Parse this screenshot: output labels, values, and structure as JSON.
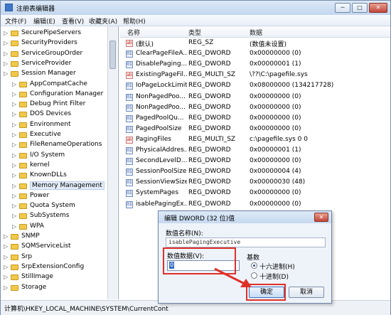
{
  "window": {
    "title": "注册表编辑器",
    "controls": [
      "─",
      "□",
      "✕"
    ]
  },
  "menu": [
    "文件(F)",
    "编辑(E)",
    "查看(V)",
    "收藏夹(A)",
    "帮助(H)"
  ],
  "tree": [
    {
      "label": "SecurePipeServers",
      "indent": 0
    },
    {
      "label": "SecurityProviders",
      "indent": 0
    },
    {
      "label": "ServiceGroupOrder",
      "indent": 0
    },
    {
      "label": "ServiceProvider",
      "indent": 0
    },
    {
      "label": "Session Manager",
      "indent": 0
    },
    {
      "label": "AppCompatCache",
      "indent": 1
    },
    {
      "label": "Configuration Manager",
      "indent": 1
    },
    {
      "label": "Debug Print Filter",
      "indent": 1
    },
    {
      "label": "DOS Devices",
      "indent": 1
    },
    {
      "label": "Environment",
      "indent": 1
    },
    {
      "label": "Executive",
      "indent": 1
    },
    {
      "label": "FileRenameOperations",
      "indent": 1
    },
    {
      "label": "I/O System",
      "indent": 1
    },
    {
      "label": "kernel",
      "indent": 1
    },
    {
      "label": "KnownDLLs",
      "indent": 1
    },
    {
      "label": "Memory Management",
      "indent": 1,
      "selected": true
    },
    {
      "label": "Power",
      "indent": 1
    },
    {
      "label": "Quota System",
      "indent": 1
    },
    {
      "label": "SubSystems",
      "indent": 1
    },
    {
      "label": "WPA",
      "indent": 1
    },
    {
      "label": "SNMP",
      "indent": 0
    },
    {
      "label": "SQMServiceList",
      "indent": 0
    },
    {
      "label": "Srp",
      "indent": 0
    },
    {
      "label": "SrpExtensionConfig",
      "indent": 0
    },
    {
      "label": "StillImage",
      "indent": 0
    },
    {
      "label": "Storage",
      "indent": 0
    }
  ],
  "values_header": {
    "name": "名称",
    "type": "类型",
    "data": "数据"
  },
  "values": [
    {
      "name": "(默认)",
      "type": "REG_SZ",
      "data": "(数值未设置)",
      "kind": "sz"
    },
    {
      "name": "ClearPageFileA...",
      "type": "REG_DWORD",
      "data": "0x00000000 (0)",
      "kind": "dw"
    },
    {
      "name": "DisablePaging...",
      "type": "REG_DWORD",
      "data": "0x00000001 (1)",
      "kind": "dw"
    },
    {
      "name": "ExistingPageFil...",
      "type": "REG_MULTI_SZ",
      "data": "\\??\\C:\\pagefile.sys",
      "kind": "sz"
    },
    {
      "name": "IoPageLockLimit",
      "type": "REG_DWORD",
      "data": "0x08000000 (134217728)",
      "kind": "dw"
    },
    {
      "name": "NonPagedPoo...",
      "type": "REG_DWORD",
      "data": "0x00000000 (0)",
      "kind": "dw"
    },
    {
      "name": "NonPagedPoo...",
      "type": "REG_DWORD",
      "data": "0x00000000 (0)",
      "kind": "dw"
    },
    {
      "name": "PagedPoolQu...",
      "type": "REG_DWORD",
      "data": "0x00000000 (0)",
      "kind": "dw"
    },
    {
      "name": "PagedPoolSize",
      "type": "REG_DWORD",
      "data": "0x00000000 (0)",
      "kind": "dw"
    },
    {
      "name": "PagingFiles",
      "type": "REG_MULTI_SZ",
      "data": "c:\\pagefile.sys 0 0",
      "kind": "sz"
    },
    {
      "name": "PhysicalAddres...",
      "type": "REG_DWORD",
      "data": "0x00000001 (1)",
      "kind": "dw"
    },
    {
      "name": "SecondLevelD...",
      "type": "REG_DWORD",
      "data": "0x00000000 (0)",
      "kind": "dw"
    },
    {
      "name": "SessionPoolSize",
      "type": "REG_DWORD",
      "data": "0x00000004 (4)",
      "kind": "dw"
    },
    {
      "name": "SessionViewSize",
      "type": "REG_DWORD",
      "data": "0x00000030 (48)",
      "kind": "dw"
    },
    {
      "name": "SystemPages",
      "type": "REG_DWORD",
      "data": "0x00000000 (0)",
      "kind": "dw"
    },
    {
      "name": "isablePagingEx...",
      "type": "REG_DWORD",
      "data": "0x00000000 (0)",
      "kind": "dw"
    }
  ],
  "status": "计算机\\HKEY_LOCAL_MACHINE\\SYSTEM\\CurrentCont",
  "dialog": {
    "title": "编辑 DWORD (32 位)值",
    "close": "✕",
    "name_label": "数值名称(N):",
    "name_value": "isablePagingExecutive",
    "data_label": "数值数据(V):",
    "data_value": "0",
    "base_label": "基数",
    "hex_label": "十六进制(H)",
    "dec_label": "十进制(D)",
    "ok": "确定",
    "cancel": "取消"
  },
  "colors": {
    "highlight": "#e0302a",
    "accent": "#3a6fc4"
  }
}
